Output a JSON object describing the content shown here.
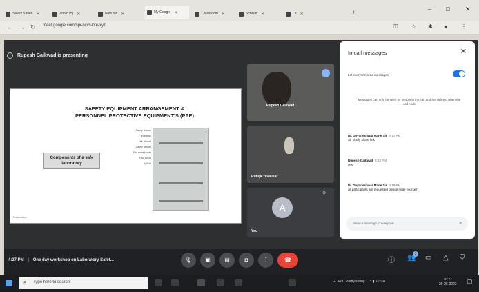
{
  "browser": {
    "tabs": [
      {
        "label": "Select Saved"
      },
      {
        "label": "Zoom (5)"
      },
      {
        "label": "New tab"
      },
      {
        "label": "My Google"
      },
      {
        "label": "Classroom"
      },
      {
        "label": "Scholar"
      },
      {
        "label": "La"
      }
    ],
    "url": "meet.google.com/spi-ncvs-bfe-xyz",
    "window_controls": {
      "minimize": "–",
      "maximize": "□",
      "close": "✕"
    }
  },
  "meet": {
    "presenting_banner": "Rupesh Gaikwad is presenting",
    "slide": {
      "title_line1": "SAFETY EQUIPMENT ARRANGEMENT &",
      "title_line2": "PERSONNEL PROTECTIVE EQUIPMENT'S (PPE)",
      "box_text": "Components of a safe laboratory",
      "side_labels": [
        "Safety shower",
        "Eyewash",
        "Fire blanket",
        "Safety cabinet",
        "Fire extinguisher",
        "First aid kit",
        "Spill kit"
      ],
      "footer": "Presentation"
    },
    "participants": [
      {
        "name": "Rupesh Gaikwad"
      },
      {
        "name": "Rutuja Yewalkar"
      },
      {
        "name": "You",
        "avatar_letter": "A"
      }
    ],
    "chat": {
      "title": "In-call messages",
      "allow_label": "Let everyone send messages",
      "notice": "Messages can only be seen by people in the call and are deleted when the call ends",
      "messages": [
        {
          "sender": "Dr. Dnyaneshwar Mane Sir",
          "time": "4:17 PM",
          "text": "Sir kindly share link"
        },
        {
          "sender": "Rupesh Gaikwad",
          "time": "4:18 PM",
          "text": "yes"
        },
        {
          "sender": "Dr. Dnyaneshwar Mane Sir",
          "time": "4:19 PM",
          "text": "all participants are requested please mute yourself"
        }
      ],
      "input_placeholder": "Send a message to everyone"
    },
    "controls": {
      "time": "4:27 PM",
      "meeting_title": "One day workshop on Laboratory Safet...",
      "participant_count": "3"
    }
  },
  "taskbar": {
    "search_placeholder": "Type here to search",
    "weather": "34°C Partly sunny",
    "time": "16:27",
    "date": "29-06-2022"
  }
}
